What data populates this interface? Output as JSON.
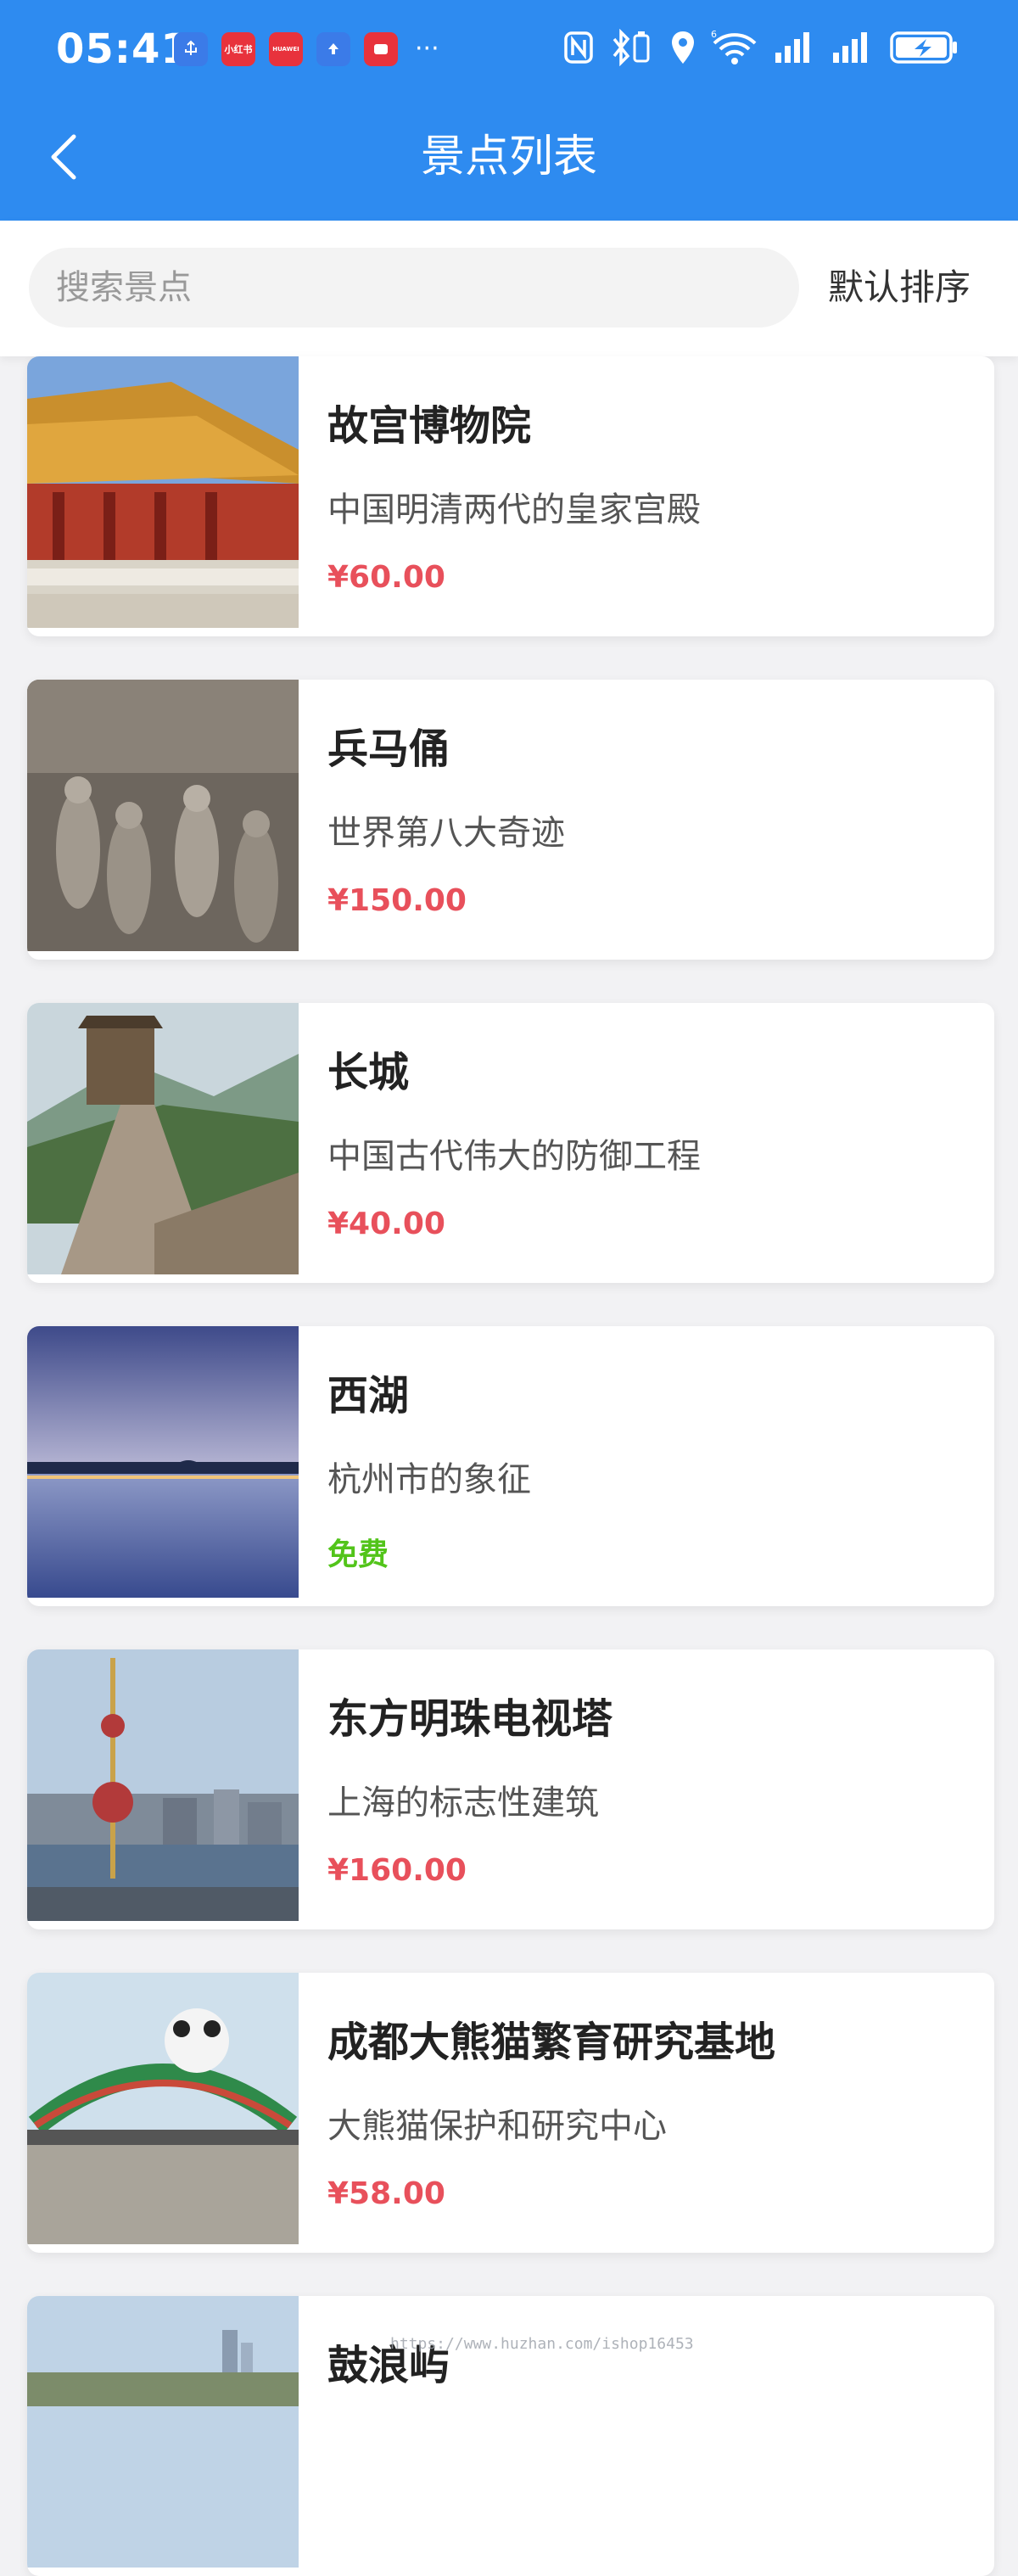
{
  "status_bar": {
    "time": "05:41",
    "notification_icons": [
      "usb-icon",
      "xiaohongshu-icon",
      "huawei-store-icon",
      "upload-icon",
      "app-icon"
    ],
    "notification_labels": [
      "",
      "小红书",
      "HUAWEI",
      "",
      ""
    ],
    "more": "···",
    "system_icons": [
      "nfc-icon",
      "bluetooth-icon",
      "location-icon",
      "wifi-icon",
      "signal-icon",
      "signal-icon",
      "battery-charging-icon"
    ]
  },
  "navbar": {
    "title": "景点列表"
  },
  "search": {
    "placeholder": "搜索景点",
    "value": "",
    "sort_label": "默认排序"
  },
  "attractions": [
    {
      "name": "故宫博物院",
      "desc": "中国明清两代的皇家宫殿",
      "price": "¥60.00",
      "free": false,
      "image": "forbidden-city"
    },
    {
      "name": "兵马俑",
      "desc": "世界第八大奇迹",
      "price": "¥150.00",
      "free": false,
      "image": "terracotta-army"
    },
    {
      "name": "长城",
      "desc": "中国古代伟大的防御工程",
      "price": "¥40.00",
      "free": false,
      "image": "great-wall"
    },
    {
      "name": "西湖",
      "desc": "杭州市的象征",
      "price": "免费",
      "free": true,
      "image": "west-lake"
    },
    {
      "name": "东方明珠电视塔",
      "desc": "上海的标志性建筑",
      "price": "¥160.00",
      "free": false,
      "image": "oriental-pearl-tower"
    },
    {
      "name": "成都大熊猫繁育研究基地",
      "desc": "大熊猫保护和研究中心",
      "price": "¥58.00",
      "free": false,
      "image": "panda-base"
    },
    {
      "name": "鼓浪屿",
      "desc": "",
      "price": "",
      "free": false,
      "image": "gulangyu"
    }
  ],
  "watermark": "https://www.huzhan.com/ishop16453",
  "colors": {
    "header": "#2e8bf0",
    "price": "#e8505b",
    "free": "#52c41a"
  }
}
